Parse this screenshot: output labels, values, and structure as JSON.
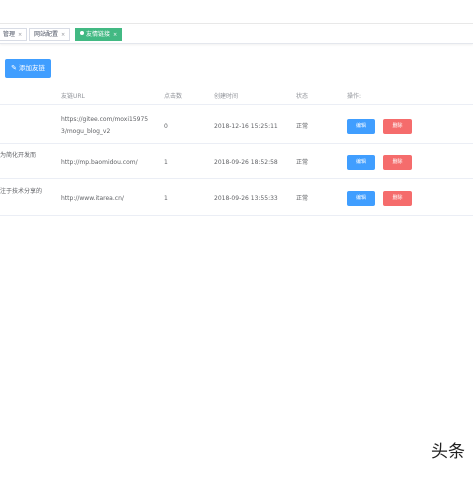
{
  "tags": [
    {
      "label": "管理",
      "close": "×"
    },
    {
      "label": "网站配置",
      "close": "×"
    },
    {
      "label": "友情链接",
      "close": "×"
    }
  ],
  "toolbar": {
    "add_label": "添加友链",
    "add_icon": "pencil-icon"
  },
  "table": {
    "headers": {
      "url": "友链URL",
      "clicks": "点击数",
      "created": "创建时间",
      "status": "状态",
      "actions": "操作:"
    },
    "rows": [
      {
        "intro": "",
        "url_line1": "https://gitee.com/moxi15975",
        "url_line2": "3/mogu_blog_v2",
        "clicks": "0",
        "created": "2018-12-16 15:25:11",
        "status": "正常",
        "edit": "编辑",
        "delete": "删除"
      },
      {
        "intro": "为简化开发而",
        "url_line1": "http://mp.baomidou.com/",
        "url_line2": "",
        "clicks": "1",
        "created": "2018-09-26 18:52:58",
        "status": "正常",
        "edit": "编辑",
        "delete": "删除"
      },
      {
        "intro": "注于技术分享的",
        "url_line1": "http://www.itarea.cn/",
        "url_line2": "",
        "clicks": "1",
        "created": "2018-09-26 13:55:33",
        "status": "正常",
        "edit": "编辑",
        "delete": "删除"
      }
    ]
  },
  "watermark": "头条",
  "colors": {
    "primary": "#409eff",
    "danger": "#f56c6c",
    "active_tag": "#42b983"
  }
}
